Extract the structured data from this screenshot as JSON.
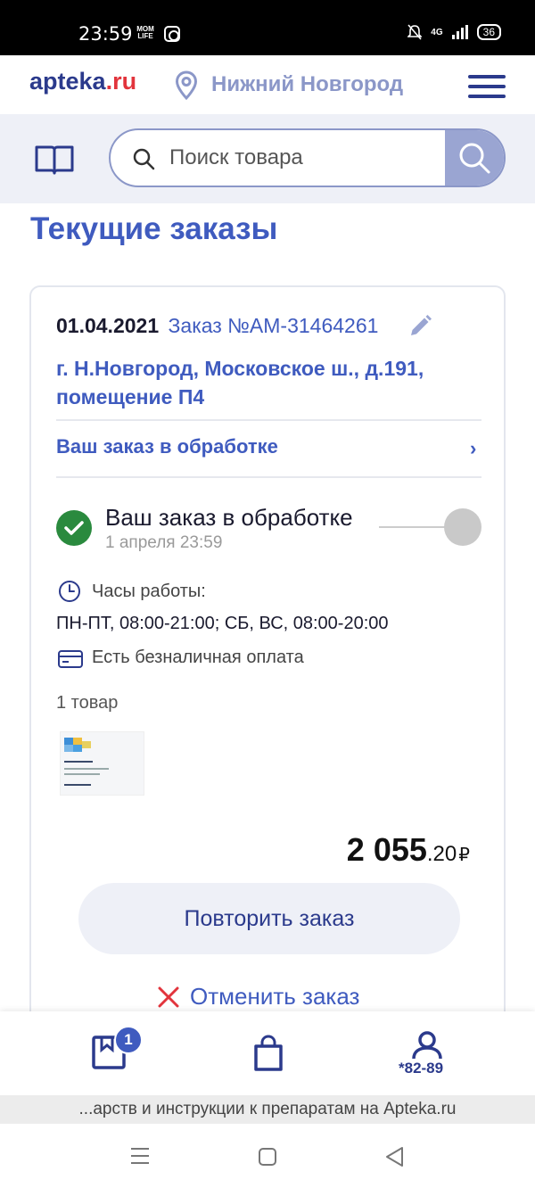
{
  "status_bar": {
    "time": "23:59",
    "app_badge": "MOM LIFE",
    "network": "4G",
    "battery": "36"
  },
  "header": {
    "logo_main": "apteka",
    "logo_tld": ".ru",
    "city": "Нижний Новгород"
  },
  "search": {
    "placeholder": "Поиск товара"
  },
  "page_title": "Текущие заказы",
  "order": {
    "date": "01.04.2021",
    "number": "Заказ №АМ-31464261",
    "address": "г. Н.Новгород, Московское ш., д.191, помещение П4",
    "status_link": "Ваш заказ в обработке",
    "chevron": "›",
    "progress": {
      "title": "Ваш заказ в обработке",
      "time": "1 апреля 23:59"
    },
    "hours_label": "Часы работы:",
    "hours_value": "ПН-ПТ, 08:00-21:00; СБ, ВС, 08:00-20:00",
    "cashless": "Есть безналичная оплата",
    "items_count": "1 товар",
    "price_int": "2 055",
    "price_frac": ".20",
    "currency": "₽",
    "repeat_label": "Повторить заказ",
    "cancel_label": "Отменить заказ"
  },
  "bottom_nav": {
    "orders_badge": "1",
    "phone_suffix": "*82-89"
  },
  "url_bar": "...арств и инструкции к препаратам на Apteka.ru",
  "colors": {
    "brand": "#2b3a8c",
    "accent": "#3f5bbf",
    "logo_red": "#e2343c",
    "success": "#2a8a3e",
    "cancel_red": "#e2343c"
  },
  "icons": [
    "map-pin-icon",
    "menu-icon",
    "book-icon",
    "search-icon",
    "edit-icon",
    "check-icon",
    "clock-icon",
    "credit-card-icon",
    "close-icon",
    "orders-icon",
    "cart-icon",
    "profile-icon"
  ]
}
